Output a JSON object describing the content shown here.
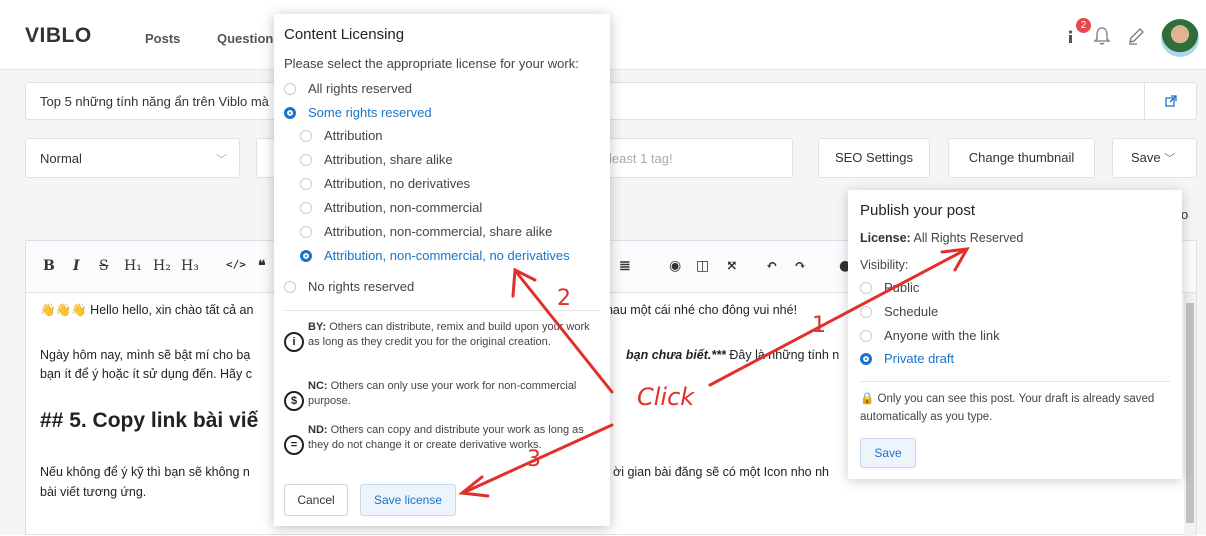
{
  "header": {
    "logo": "VIBLO",
    "nav": [
      "Posts",
      "Question"
    ],
    "notification_count": "2"
  },
  "editor_meta": {
    "title_value": "Top 5 những tính năng ẩn trên Viblo mà",
    "select_value": "Normal",
    "tags_placeholder": "least 1 tag!",
    "seo_label": "SEO Settings",
    "thumbnail_label": "Change thumbnail",
    "save_label": "Save",
    "right_cut": "o"
  },
  "toolbar": {
    "bold": "B",
    "italic": "I",
    "strike": "S",
    "h1": "H₁",
    "h2": "H₂",
    "h3": "H₃"
  },
  "content": {
    "line1_left": "👋👋👋 Hello hello, xin chào tất cả an",
    "line1_right": "nhau một cái nhé cho đông vui nhé!",
    "line2_left": "Ngày hôm nay, mình sẽ bật mí cho bạ",
    "line2_right_bold": "bạn chưa biết.***",
    "line2_right": " Đây là những tính n",
    "line3_left": "bạn ít để ý hoặc ít sử dụng đến. Hãy c",
    "heading": "## 5. Copy link bài viế",
    "line4_left": "Nếu không để ý kỹ thì bạn sẽ không n",
    "line4_right": "ời gian bài đăng sẽ có một Icon nho nh",
    "line5_left": "bài viết tương ứng."
  },
  "license_modal": {
    "title": "Content  Licensing",
    "subtitle": "Please select the appropriate license for your work:",
    "options": [
      {
        "label": "All rights reserved",
        "selected": false
      },
      {
        "label": "Some rights reserved",
        "selected": true
      },
      {
        "label": "Attribution",
        "selected": false
      },
      {
        "label": "Attribution, share alike",
        "selected": false
      },
      {
        "label": "Attribution, no derivatives",
        "selected": false
      },
      {
        "label": "Attribution, non-commercial",
        "selected": false
      },
      {
        "label": "Attribution, non-commercial, share alike",
        "selected": false
      },
      {
        "label": "Attribution, non-commercial, no derivatives",
        "selected": true
      },
      {
        "label": "No rights reserved",
        "selected": false
      }
    ],
    "by_label": "BY:",
    "by_text": " Others can distribute, remix and build upon your work as long as they credit you for the original creation.",
    "nc_label": "NC:",
    "nc_text": " Others can only use your work for non-commercial purpose.",
    "nd_label": "ND:",
    "nd_text": " Others can copy and distribute your work as long as they do not change it or create derivative works.",
    "cancel_label": "Cancel",
    "save_label": "Save license"
  },
  "publish": {
    "title": "Publish  your  post",
    "license_key": "License:",
    "license_value": " All Rights Reserved",
    "visibility_label": "Visibility:",
    "options": [
      {
        "label": "Public",
        "selected": false
      },
      {
        "label": "Schedule",
        "selected": false
      },
      {
        "label": "Anyone with the link",
        "selected": false
      },
      {
        "label": "Private draft",
        "selected": true
      }
    ],
    "note": "Only you can see this post. Your draft is already saved automatically as you type.",
    "save_label": "Save"
  },
  "annotations": {
    "click": "Click",
    "n1": "1",
    "n2": "2",
    "n3": "3",
    "color": "#e0302a"
  }
}
